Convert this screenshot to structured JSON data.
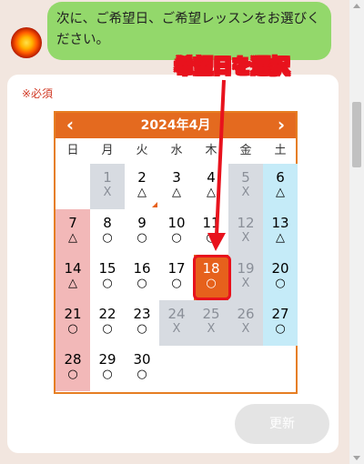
{
  "chat": {
    "message": "次に、ご希望日、ご希望レッスンをお選びください。"
  },
  "form": {
    "required_label": "※必須",
    "update_button": "更新"
  },
  "calendar": {
    "title": "2024年4月",
    "prev_icon": "chevron-left-icon",
    "next_icon": "chevron-right-icon",
    "prev_glyph": "‹",
    "next_glyph": "›",
    "weekdays": [
      "日",
      "月",
      "火",
      "水",
      "木",
      "金",
      "土"
    ],
    "leading_blanks": 1,
    "selected_day": 18,
    "days": [
      {
        "day": "1",
        "mark": "X",
        "status": "closed"
      },
      {
        "day": "2",
        "mark": "△",
        "status": "open",
        "flag": true
      },
      {
        "day": "3",
        "mark": "△",
        "status": "open"
      },
      {
        "day": "4",
        "mark": "△",
        "status": "open"
      },
      {
        "day": "5",
        "mark": "X",
        "status": "closed"
      },
      {
        "day": "6",
        "mark": "△",
        "status": "sat"
      },
      {
        "day": "7",
        "mark": "△",
        "status": "sun"
      },
      {
        "day": "8",
        "mark": "○",
        "status": "open"
      },
      {
        "day": "9",
        "mark": "○",
        "status": "open"
      },
      {
        "day": "10",
        "mark": "○",
        "status": "open"
      },
      {
        "day": "11",
        "mark": "○",
        "status": "open"
      },
      {
        "day": "12",
        "mark": "X",
        "status": "closed"
      },
      {
        "day": "13",
        "mark": "△",
        "status": "sat"
      },
      {
        "day": "14",
        "mark": "△",
        "status": "sun"
      },
      {
        "day": "15",
        "mark": "○",
        "status": "open"
      },
      {
        "day": "16",
        "mark": "○",
        "status": "open"
      },
      {
        "day": "17",
        "mark": "○",
        "status": "open"
      },
      {
        "day": "18",
        "mark": "○",
        "status": "selected"
      },
      {
        "day": "19",
        "mark": "X",
        "status": "closed"
      },
      {
        "day": "20",
        "mark": "○",
        "status": "sat"
      },
      {
        "day": "21",
        "mark": "○",
        "status": "sun"
      },
      {
        "day": "22",
        "mark": "○",
        "status": "open"
      },
      {
        "day": "23",
        "mark": "○",
        "status": "open"
      },
      {
        "day": "24",
        "mark": "X",
        "status": "closed"
      },
      {
        "day": "25",
        "mark": "X",
        "status": "closed"
      },
      {
        "day": "26",
        "mark": "X",
        "status": "closed"
      },
      {
        "day": "27",
        "mark": "○",
        "status": "sat"
      },
      {
        "day": "28",
        "mark": "○",
        "status": "sun"
      },
      {
        "day": "29",
        "mark": "○",
        "status": "open"
      },
      {
        "day": "30",
        "mark": "○",
        "status": "open"
      }
    ]
  },
  "annotation": {
    "label": "希望日を選択",
    "color": "#e8121d"
  },
  "colors": {
    "bubble": "#93d86b",
    "accent": "#e46a1f",
    "sunday": "#f2b8b8",
    "saturday": "#c5ebf8",
    "closed": "#d7dbe1",
    "required": "#d13a25",
    "background": "#f2e6df"
  }
}
